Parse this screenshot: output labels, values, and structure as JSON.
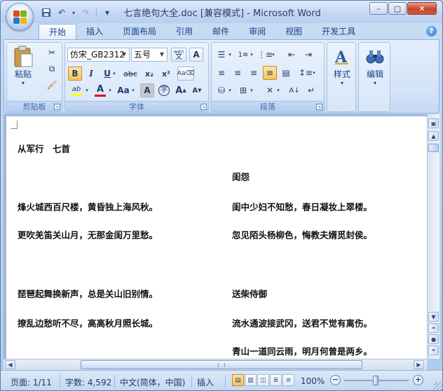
{
  "window": {
    "title": "七言绝句大全.doc [兼容模式] - Microsoft Word",
    "controls": {
      "minimize": "–",
      "maximize": "▢",
      "close": "✕"
    }
  },
  "quick_access": {
    "save_icon": "floppy-disk-icon",
    "undo": "↶",
    "redo": "↷",
    "customize": "▾"
  },
  "ribbon": {
    "tabs": [
      "开始",
      "插入",
      "页面布局",
      "引用",
      "邮件",
      "审阅",
      "视图",
      "开发工具"
    ],
    "active_tab": "开始",
    "help": "?",
    "groups": {
      "clipboard": {
        "label": "剪贴板",
        "paste": "粘贴"
      },
      "font": {
        "label": "字体",
        "font_name": "仿宋_GB2312",
        "font_size": "五号",
        "bold": "B",
        "italic": "I",
        "underline": "U",
        "strike": "abc",
        "subscript": "x₂",
        "superscript": "x²",
        "change_case": "Aa",
        "grow": "A",
        "shrink": "A",
        "font_color": "A",
        "highlight": "ab",
        "phonetic": "wén 文",
        "char_border": "A",
        "char_shading": "A",
        "enclose": "字",
        "clear_format": "Aa"
      },
      "paragraph": {
        "label": "段落"
      },
      "styles": {
        "label": "样式"
      },
      "editing": {
        "label": "编辑"
      }
    }
  },
  "document": {
    "poem1_title": "从军行　七首",
    "poem1_lines": [
      "烽火城西百尺楼，黄昏独上海风秋。",
      "更吹羌笛关山月，无那金闺万里愁。",
      "琵琶起舞换新声，总是关山旧别情。",
      "撩乱边愁听不尽，高高秋月照长城。"
    ],
    "poem2_title": "闺怨",
    "poem2_lines": [
      "闺中少妇不知愁，春日凝妆上翠楼。",
      "忽见陌头杨柳色，悔教夫婿觅封侯。"
    ],
    "poem3_title": "送柴侍御",
    "poem3_lines": [
      "流水通波接武冈，送君不觉有离伤。",
      "青山一道同云雨，明月何曾是两乡。"
    ]
  },
  "statusbar": {
    "page": "页面: 1/11",
    "words": "字数: 4,592",
    "language": "中文(简体，中国)",
    "mode": "插入",
    "zoom": "100%",
    "zoom_out": "−",
    "zoom_in": "+"
  },
  "colors": {
    "ribbon_accent": "#15428b",
    "font_color_red": "#e0001b",
    "highlight_yellow": "#ffff00"
  }
}
